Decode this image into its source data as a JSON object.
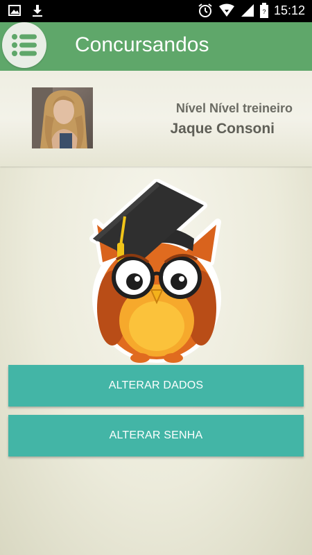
{
  "status_bar": {
    "time": "15:12",
    "icons": [
      "image-icon",
      "download-icon",
      "alarm-icon",
      "wifi-icon",
      "signal-icon",
      "battery-icon"
    ]
  },
  "app_bar": {
    "title": "Concursandos",
    "menu_icon": "list-menu-icon",
    "color": "#5fa76a"
  },
  "profile": {
    "level": "Nível Nível treineiro",
    "name": "Jaque Consoni"
  },
  "mascot": {
    "icon": "graduate-owl-mascot"
  },
  "actions": {
    "edit_data": "ALTERAR DADOS",
    "change_password": "ALTERAR SENHA",
    "button_color": "#43b5a6"
  }
}
